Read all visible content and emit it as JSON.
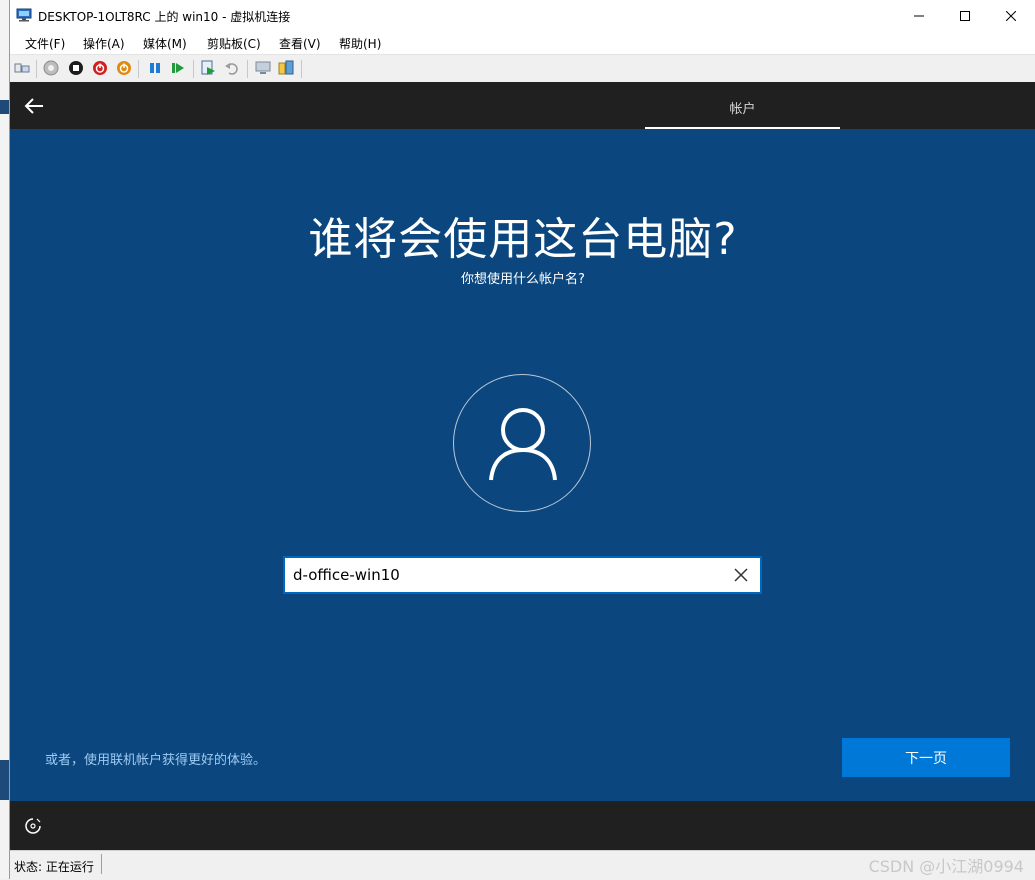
{
  "window": {
    "title": "DESKTOP-1OLT8RC 上的 win10 - 虚拟机连接",
    "controls": [
      "minimize-icon",
      "maximize-icon",
      "close-icon"
    ]
  },
  "menu": {
    "items": [
      {
        "label": "文件(F)"
      },
      {
        "label": "操作(A)"
      },
      {
        "label": "媒体(M)"
      },
      {
        "label": "剪贴板(C)"
      },
      {
        "label": "查看(V)"
      },
      {
        "label": "帮助(H)"
      }
    ]
  },
  "toolbar": {
    "icons": [
      "ctrl-alt-del-icon",
      "start-icon",
      "turn-off-icon",
      "shutdown-icon",
      "save-icon",
      "pause-icon",
      "resume-icon",
      "checkpoint-icon",
      "revert-icon",
      "enhanced-session-icon",
      "share-icon"
    ]
  },
  "vm": {
    "top_bar": {
      "tab_label": "帐户"
    },
    "heading": "谁将会使用这台电脑?",
    "subheading": "你想使用什么帐户名?",
    "name_input": {
      "value": "d-office-win10"
    },
    "online_link": "或者，使用联机帐户获得更好的体验。",
    "next_button": "下一页",
    "colors": {
      "background": "#0b477e",
      "bar": "#202020",
      "accent": "#0078d7",
      "link": "#9fcbf4"
    }
  },
  "statusbar": {
    "status": "状态: 正在运行",
    "watermark": "CSDN @小江湖0994"
  }
}
